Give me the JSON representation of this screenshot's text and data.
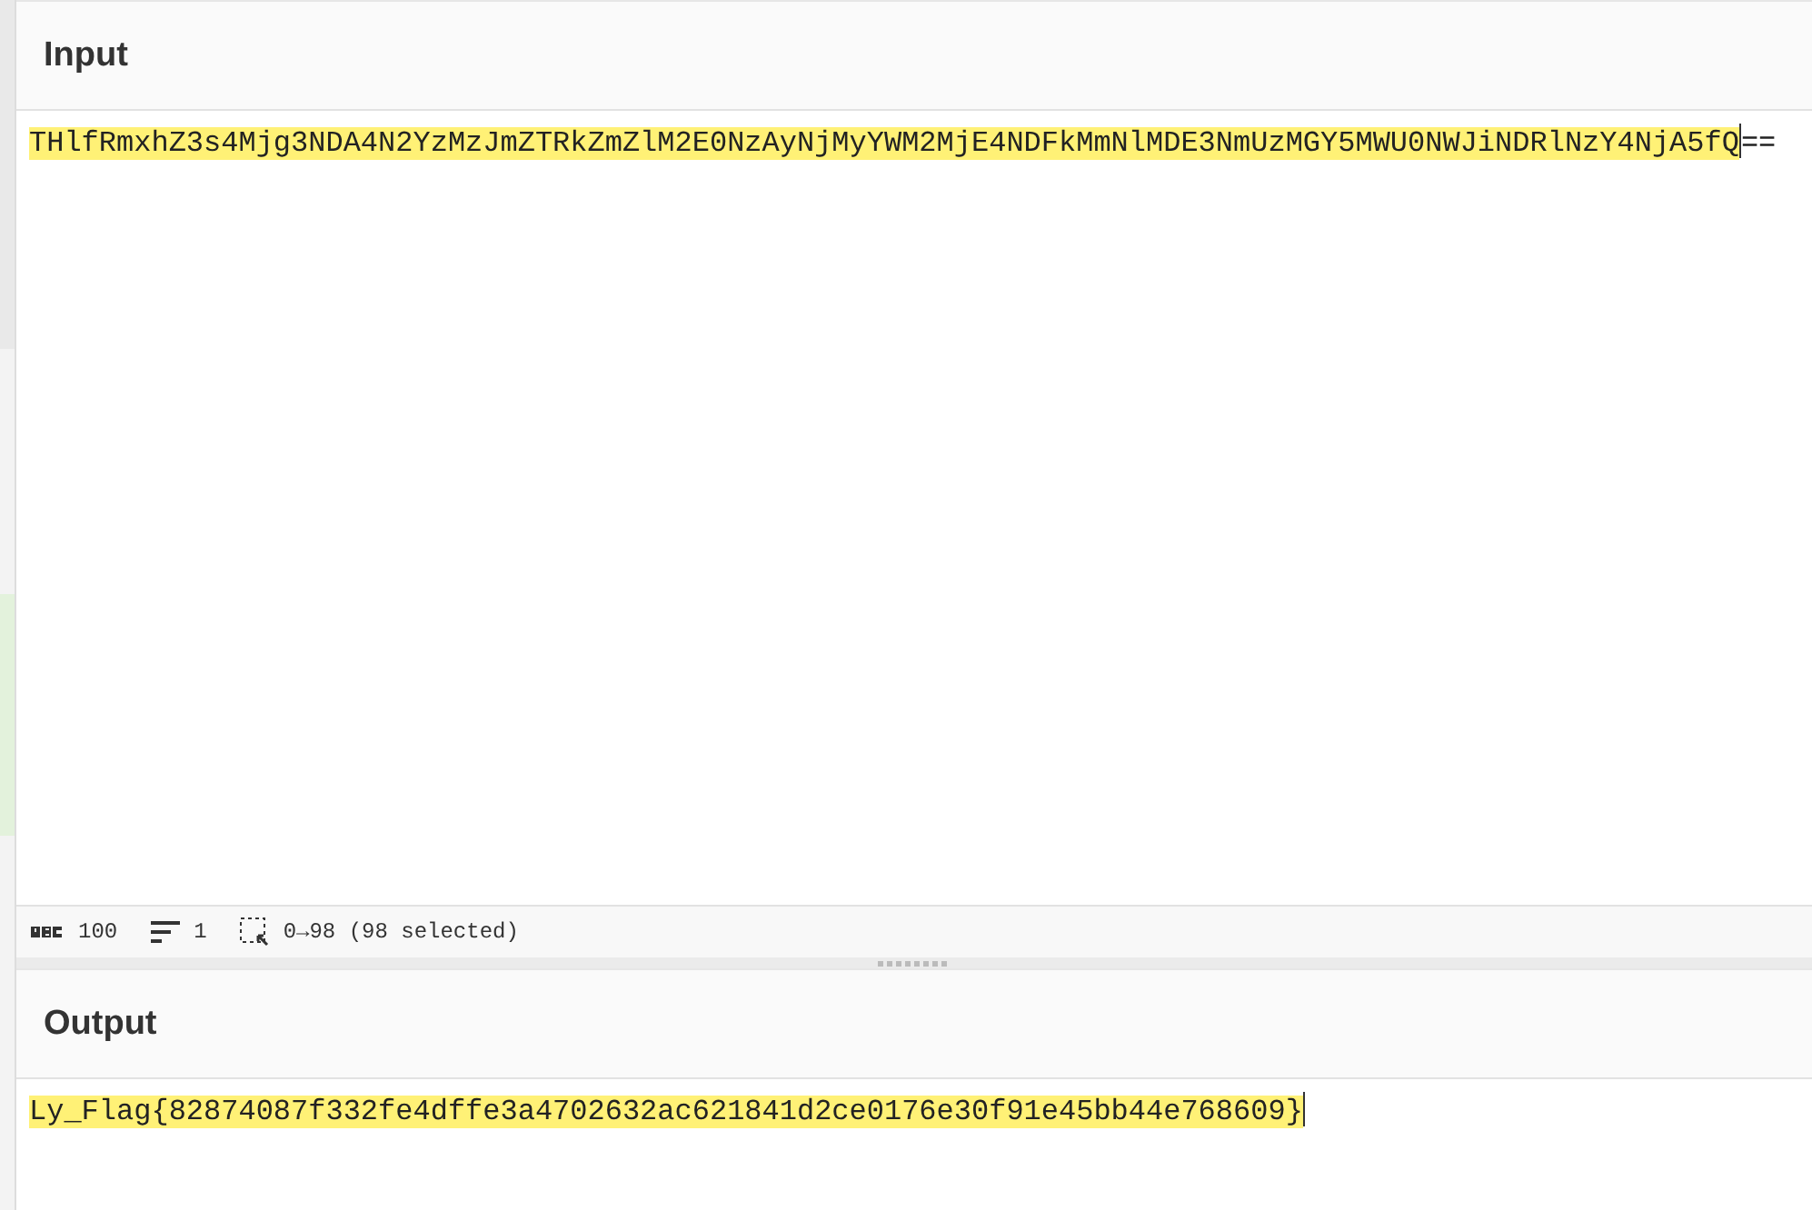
{
  "input": {
    "title": "Input",
    "segments": [
      {
        "text": "THlfRmxhZ3s4Mjg3NDA4N2YzMzJmZTRkZmZlM2E0NzAyNjMyYWM2MjE4NDFkMmNlMDE3NmUzMGY5MWU0NWJiNDRlNzY4NjA5fQ",
        "selected": true
      },
      {
        "text": "==",
        "selected": false
      }
    ]
  },
  "status_bar": {
    "length": "100",
    "lines": "1",
    "selection": "0→98 (98 selected)"
  },
  "output": {
    "title": "Output",
    "segments": [
      {
        "text": "Ly_Flag{82874087f332fe4dffe3a4702632ac621841d2ce0176e30f91e45bb44e768609}",
        "selected": true
      }
    ]
  }
}
